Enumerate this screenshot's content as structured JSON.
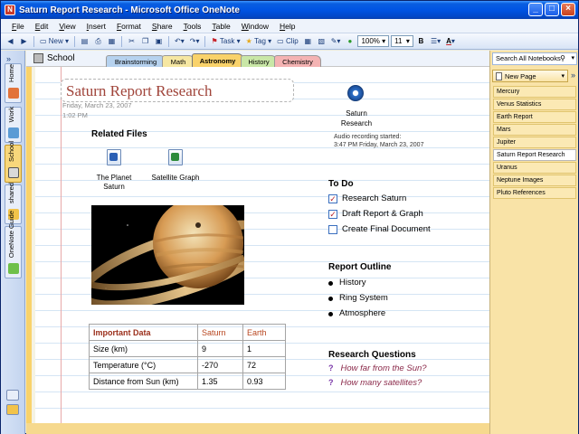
{
  "window": {
    "title": "Saturn Report Research - Microsoft Office OneNote"
  },
  "menu": [
    "File",
    "Edit",
    "View",
    "Insert",
    "Format",
    "Share",
    "Tools",
    "Table",
    "Window",
    "Help"
  ],
  "toolbar": {
    "new_label": "New",
    "task_label": "Task",
    "tag_label": "Tag",
    "clip_label": "Clip",
    "zoom": "100%",
    "font_size": "11",
    "bold": "B",
    "font_color": "A"
  },
  "notebooks": [
    "Home",
    "Work",
    "School",
    "shared",
    "OneNote Guide"
  ],
  "notebook_title": "School",
  "section_tabs": [
    {
      "label": "Brainstorming",
      "color": "#b6d2ef"
    },
    {
      "label": "Math",
      "color": "#f6e7a2"
    },
    {
      "label": "Astronomy",
      "color": "#f9d26a"
    },
    {
      "label": "History",
      "color": "#c9e7a7"
    },
    {
      "label": "Chemistry",
      "color": "#f4b3b3"
    }
  ],
  "page": {
    "title": "Saturn Report Research",
    "date": "Friday, March 23, 2007",
    "time": "1:02 PM",
    "audio": {
      "label": "Saturn Research",
      "status_line1": "Audio recording started:",
      "status_line2": "3:47 PM Friday, March 23, 2007"
    },
    "related_files": {
      "heading": "Related Files",
      "files": [
        {
          "label": "The Planet Saturn",
          "icon": "word-doc-icon"
        },
        {
          "label": "Satellite Graph",
          "icon": "excel-sheet-icon"
        }
      ]
    },
    "table": {
      "headers": [
        "Important Data",
        "Saturn",
        "Earth"
      ],
      "rows": [
        [
          "Size (km)",
          "9",
          "1"
        ],
        [
          "Temperature (°C)",
          "-270",
          "72"
        ],
        [
          "Distance from Sun (km)",
          "1.35",
          "0.93"
        ]
      ]
    },
    "todo": {
      "heading": "To Do",
      "items": [
        {
          "label": "Research Saturn",
          "checked": true
        },
        {
          "label": "Draft Report & Graph",
          "checked": true
        },
        {
          "label": "Create Final Document",
          "checked": false
        }
      ]
    },
    "outline": {
      "heading": "Report Outline",
      "items": [
        "History",
        "Ring System",
        "Atmosphere"
      ]
    },
    "questions": {
      "heading": "Research Questions",
      "items": [
        "How far from the Sun?",
        "How many satellites?"
      ]
    }
  },
  "right_panel": {
    "search_label": "Search All Notebooks",
    "new_page_label": "New Page",
    "pages": [
      "Mercury",
      "Venus Statistics",
      "Earth Report",
      "Mars",
      "Jupiter",
      "Saturn Report Research",
      "Uranus",
      "Neptune Images",
      "Pluto References"
    ],
    "active_page": "Saturn Report Research"
  }
}
